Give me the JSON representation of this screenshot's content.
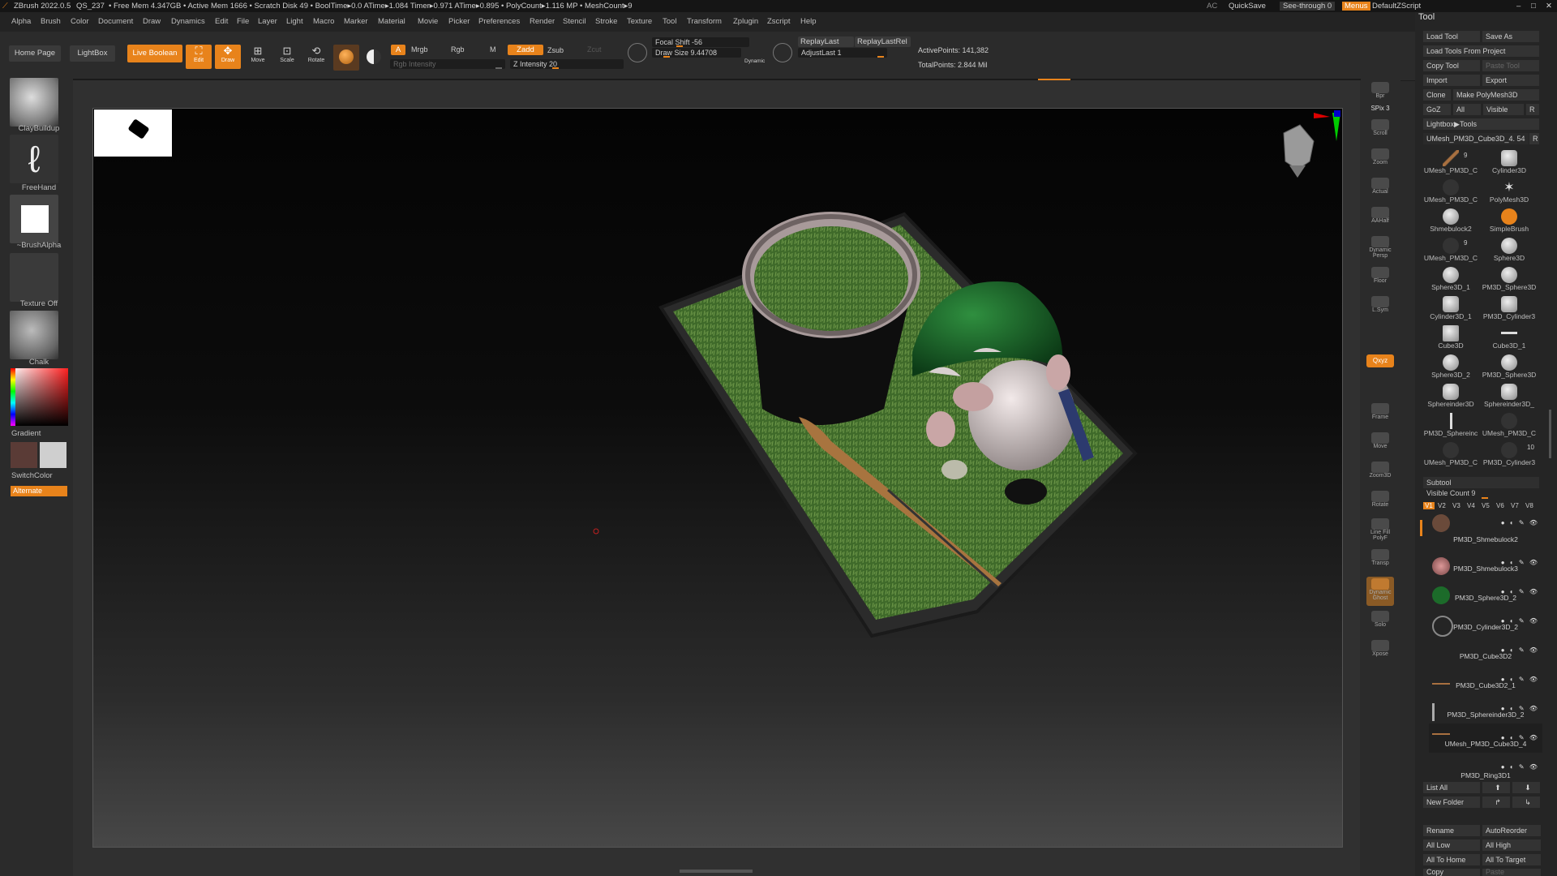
{
  "titlebar": {
    "app": "ZBrush 2022.0.5",
    "doc": "QS_237",
    "stats": "• Free Mem 4.347GB • Active Mem 1666 • Scratch Disk 49 • BoolTime▸0.0 ATime▸1.084 Timer▸0.971 ATime▸0.895 • PolyCount▸1.116 MP • MeshCount▸9",
    "ac": "AC",
    "quicksave": "QuickSave",
    "see_through": "See-through  0",
    "menus": "Menus",
    "script": "DefaultZScript"
  },
  "menu": [
    "Alpha",
    "Brush",
    "Color",
    "Document",
    "Draw",
    "Dynamics",
    "Edit",
    "File",
    "Layer",
    "Light",
    "Macro",
    "Marker",
    "Material",
    "Movie",
    "Picker",
    "Preferences",
    "Render",
    "Stencil",
    "Stroke",
    "Texture",
    "Tool",
    "Transform",
    "Zplugin",
    "Zscript",
    "Help"
  ],
  "shelf": {
    "home": "Home Page",
    "lightbox": "LightBox",
    "live_boolean": "Live Boolean",
    "edit": "Edit",
    "draw": "Draw",
    "move": "Move",
    "scale": "Scale",
    "rotate": "Rotate",
    "a": "A",
    "mrgb": "Mrgb",
    "rgb": "Rgb",
    "m": "M",
    "zadd": "Zadd",
    "zsub": "Zsub",
    "zcut": "Zcut",
    "rgb_intensity": "Rgb Intensity",
    "z_intensity": "Z Intensity 20",
    "focal_shift": "Focal Shift -56",
    "draw_size": "Draw Size 9.44708",
    "dynamic": "Dynamic",
    "replay_last": "ReplayLast",
    "replay_last_rel": "ReplayLastRel",
    "adjust_last": "AdjustLast 1",
    "active_points": "ActivePoints: 141,382",
    "total_points": "TotalPoints: 2.844 Mil"
  },
  "left": {
    "brush": "ClayBuildup",
    "stroke": "FreeHand",
    "alpha": "~BrushAlpha",
    "texture": "Texture Off",
    "material": "Chalk",
    "gradient": "Gradient",
    "switch_color": "SwitchColor",
    "alternate": "Alternate"
  },
  "rshelf": [
    "Bpr",
    "SPix 3",
    "Scroll",
    "Zoom",
    "Actual",
    "AAHalf",
    "Dynamic Persp",
    "Floor",
    "L.Sym",
    "Qxyz",
    "Frame",
    "Move",
    "Zoom3D",
    "Rotate",
    "Line Fill PolyF",
    "Transp",
    "Dynamic Ghost",
    "Solo",
    "Xpose"
  ],
  "tool": {
    "title": "Tool",
    "load_tool": "Load Tool",
    "save_as": "Save As",
    "load_from_project": "Load Tools From Project",
    "copy_tool": "Copy Tool",
    "paste_tool": "Paste Tool",
    "import": "Import",
    "export": "Export",
    "clone": "Clone",
    "make_polymesh": "Make PolyMesh3D",
    "goz": "GoZ",
    "all": "All",
    "visible": "Visible",
    "r": "R",
    "lightbox_tools": "Lightbox▶Tools",
    "current": "UMesh_PM3D_Cube3D_4. 54",
    "current_r": "R",
    "grid": [
      {
        "name": "UMesh_PM3D_C",
        "count": "9"
      },
      {
        "name": "Cylinder3D"
      },
      {
        "name": "UMesh_PM3D_C"
      },
      {
        "name": "PolyMesh3D"
      },
      {
        "name": "Shmebulock2"
      },
      {
        "name": "SimpleBrush"
      },
      {
        "name": "UMesh_PM3D_C",
        "count": "9"
      },
      {
        "name": "Sphere3D"
      },
      {
        "name": "Sphere3D_1"
      },
      {
        "name": "PM3D_Sphere3D"
      },
      {
        "name": "Cylinder3D_1"
      },
      {
        "name": "PM3D_Cylinder3"
      },
      {
        "name": "Cube3D"
      },
      {
        "name": "Cube3D_1"
      },
      {
        "name": "Sphere3D_2"
      },
      {
        "name": "PM3D_Sphere3D"
      },
      {
        "name": "Sphereinder3D"
      },
      {
        "name": "Sphereinder3D_"
      },
      {
        "name": "PM3D_Sphereinc"
      },
      {
        "name": "UMesh_PM3D_C"
      },
      {
        "name": "UMesh_PM3D_C"
      },
      {
        "name": "PM3D_Cylinder3",
        "count": "10"
      }
    ],
    "subtool": "Subtool",
    "visible_count": "Visible Count 9",
    "versions": [
      "V1",
      "V2",
      "V3",
      "V4",
      "V5",
      "V6",
      "V7",
      "V8"
    ],
    "subtools": [
      "PM3D_Shmebulock2",
      "PM3D_Shmebulock3",
      "PM3D_Sphere3D_2",
      "PM3D_Cylinder3D_2",
      "PM3D_Cube3D2",
      "PM3D_Cube3D2_1",
      "PM3D_Sphereinder3D_2",
      "UMesh_PM3D_Cube3D_4",
      "PM3D_Ring3D1"
    ],
    "list_all": "List All",
    "new_folder": "New Folder",
    "rename": "Rename",
    "autoreorder": "AutoReorder",
    "all_low": "All Low",
    "all_high": "All High",
    "all_to_home": "All To Home",
    "all_to_target": "All To Target",
    "copy": "Copy",
    "paste": "Paste"
  }
}
